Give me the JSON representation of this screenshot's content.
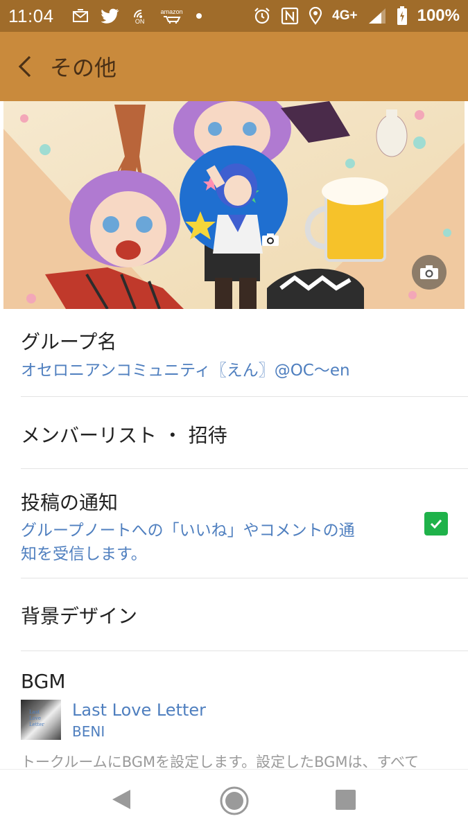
{
  "status_bar": {
    "time": "11:04",
    "amazon_label": "amazon",
    "on_label": "ON",
    "network": "4G+",
    "battery": "100%",
    "icons": [
      "mail-icon",
      "twitter-icon",
      "nfc-wallet-icon",
      "amazon-icon",
      "dot-icon",
      "alarm-icon",
      "nfc-icon",
      "location-icon",
      "signal-icon",
      "battery-icon"
    ]
  },
  "app_bar": {
    "title": "その他",
    "back_icon": "chevron-left-icon"
  },
  "cover": {
    "camera_icon": "camera-icon"
  },
  "settings": {
    "group_name": {
      "title": "グループ名",
      "value": "オセロニアンコミュニティ〖えん〗@OC〜en"
    },
    "members": {
      "title": "メンバーリスト ・ 招待"
    },
    "post_notification": {
      "title": "投稿の通知",
      "desc_line1": "グループノートへの「いいね」やコメントの通",
      "desc_line2": "知を受信します。",
      "checked": true
    },
    "background": {
      "title": "背景デザイン"
    },
    "bgm": {
      "title": "BGM",
      "song": "Last Love Letter",
      "artist": "BENI",
      "description": "トークルームにBGMを設定します。設定したBGMは、すべて"
    }
  },
  "nav_bar": {
    "icons": [
      "back-triangle-icon",
      "home-circle-icon",
      "recent-square-icon"
    ]
  },
  "colors": {
    "status_bar": "#a06c2a",
    "app_bar": "#c98a3c",
    "link_blue": "#4f7fbf",
    "checkbox_green": "#1fb24a"
  }
}
